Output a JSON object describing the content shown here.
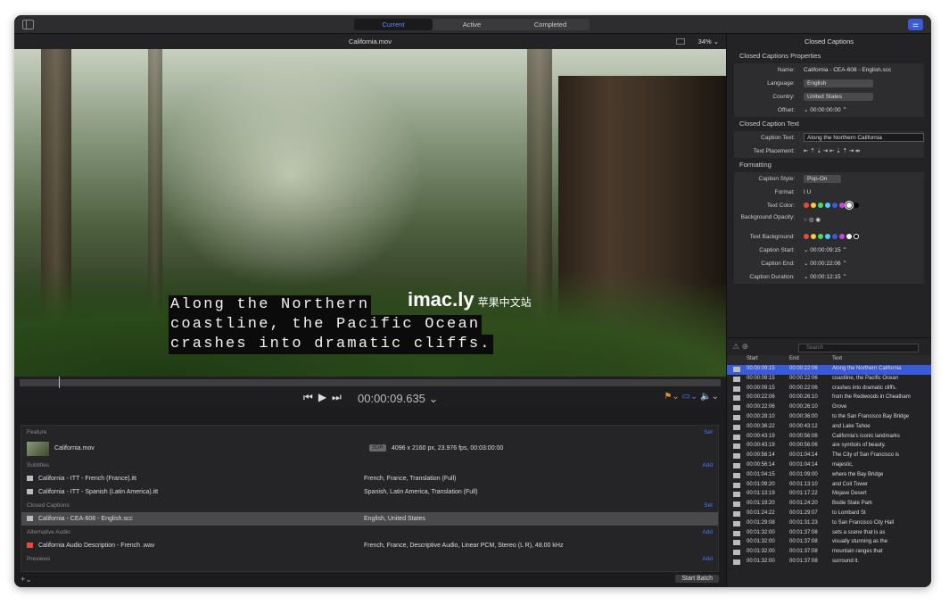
{
  "toolbar": {
    "tabs": [
      "Current",
      "Active",
      "Completed"
    ]
  },
  "viewer": {
    "title": "California.mov",
    "zoom": "34% ⌄",
    "timecode": "00:00:09.635 ⌄",
    "caption_lines": [
      "Along the Northern",
      "coastline, the Pacific Ocean",
      "crashes into dramatic cliffs."
    ],
    "watermark": "imac.ly",
    "watermark_sub": "苹果中文站"
  },
  "batch": {
    "feature_label": "Feature",
    "feature_action": "Set",
    "feature_name": "California.mov",
    "sdr": "SDR",
    "feature_info": "4096 x 2160 px, 23.976 fps, 00:03:00:00",
    "subtitles_label": "Subtitles",
    "subtitles_action": "Add",
    "subtitles": [
      {
        "name": "California - ITT - French (France).itt",
        "info": "French, France, Translation (Full)"
      },
      {
        "name": "California - ITT - Spanish (Latin America).itt",
        "info": "Spanish, Latin America, Translation (Full)"
      }
    ],
    "cc_label": "Closed Captions",
    "cc_action": "Set",
    "cc_name": "California - CEA-608 - English.scc",
    "cc_info": "English, United States",
    "audio_label": "Alternative Audio",
    "audio_action": "Add",
    "audio_name": "California Audio Description - French .wav",
    "audio_info": "French, France, Descriptive Audio, Linear PCM, Stereo (L R), 48.00 kHz",
    "previews_label": "Previews",
    "previews_action": "Add",
    "start_batch": "Start Batch"
  },
  "inspector": {
    "title": "Closed Captions",
    "props_title": "Closed Captions Properties",
    "name_label": "Name:",
    "name_value": "California - CEA-608 - English.scc",
    "language_label": "Language:",
    "language_value": "English",
    "country_label": "Country:",
    "country_value": "United States",
    "offset_label": "Offset:",
    "offset_value": "⌄ 00:00:00:00 ⌃",
    "text_title": "Closed Caption Text",
    "caption_text_label": "Caption Text:",
    "caption_text_value": "Along the Northern California",
    "placement_label": "Text Placement:",
    "placement_value": "⇤ ⇡ ⇣ ⇥ ⇤ ⇣ ⇡ ⇥ ⇹",
    "format_title": "Formatting",
    "style_label": "Caption Style:",
    "style_value": "Pop-On",
    "format_label": "Format:",
    "format_value": "I U",
    "text_color_label": "Text Color:",
    "bg_opacity_label": "Background Opacity:",
    "text_bg_label": "Text Background:",
    "start_label": "Caption Start:",
    "start_value": "⌄ 00:00:09:15 ⌃",
    "end_label": "Caption End:",
    "end_value": "⌄ 00:00:22:06 ⌃",
    "dur_label": "Caption Duration:",
    "dur_value": "⌄ 00:00:12:15 ⌃",
    "colors": [
      "#e84a3a",
      "#f2c94c",
      "#4cd964",
      "#5ac8fa",
      "#3b5bd6",
      "#c84ad6",
      "#ffffff",
      "#000000"
    ],
    "search_placeholder": "Search",
    "columns": [
      "Start",
      "End",
      "Text"
    ],
    "rows": [
      [
        "00:00:09:15",
        "00:00:22:06",
        "Along the Northern California"
      ],
      [
        "00:00:09:15",
        "00:00:22:06",
        "coastline, the Pacific Ocean"
      ],
      [
        "00:00:09:15",
        "00:00:22:06",
        "crashes into dramatic cliffs."
      ],
      [
        "00:00:22:06",
        "00:00:26:10",
        "from the Redwoods in Cheatham"
      ],
      [
        "00:00:22:06",
        "00:00:26:10",
        "Grove"
      ],
      [
        "00:00:28:10",
        "00:00:36:00",
        "to the San Francisco Bay Bridge"
      ],
      [
        "00:00:36:22",
        "00:00:43:12",
        "and Lake Tahoe"
      ],
      [
        "00:00:43:19",
        "00:00:56:06",
        "California's iconic landmarks"
      ],
      [
        "00:00:43:19",
        "00:00:56:06",
        "are symbols of beauty."
      ],
      [
        "00:00:56:14",
        "00:01:04:14",
        "The City of San Francisco is"
      ],
      [
        "00:00:56:14",
        "00:01:04:14",
        "majestic,"
      ],
      [
        "00:01:04:15",
        "00:01:09:00",
        "where the Bay Bridge"
      ],
      [
        "00:01:09:20",
        "00:01:13:10",
        "and Coit Tower"
      ],
      [
        "00:01:13:19",
        "00:01:17:22",
        "Mojave Desert"
      ],
      [
        "00:01:19:20",
        "00:01:24:20",
        "Bodie State Park"
      ],
      [
        "00:01:24:22",
        "00:01:29:07",
        "to Lombard St"
      ],
      [
        "00:01:29:08",
        "00:01:31:23",
        "to San Francisco City Hall"
      ],
      [
        "00:01:32:00",
        "00:01:37:08",
        "sets a scene that is as"
      ],
      [
        "00:01:32:00",
        "00:01:37:08",
        "visually stunning as the"
      ],
      [
        "00:01:32:00",
        "00:01:37:08",
        "mountain ranges that"
      ],
      [
        "00:01:32:00",
        "00:01:37:08",
        "surround it."
      ]
    ]
  }
}
